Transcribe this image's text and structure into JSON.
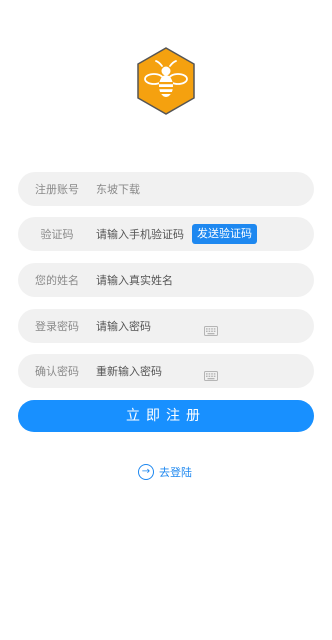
{
  "form": {
    "account": {
      "label": "注册账号",
      "placeholder": "东坡下载"
    },
    "code": {
      "label": "验证码",
      "placeholder": "请输入手机验证码",
      "send_button": "发送验证码"
    },
    "name": {
      "label": "您的姓名",
      "placeholder": "请输入真实姓名"
    },
    "password": {
      "label": "登录密码",
      "placeholder": "请输入密码",
      "icon": "keyboard-icon"
    },
    "confirm": {
      "label": "确认密码",
      "placeholder": "重新输入密码",
      "icon": "keyboard-icon"
    }
  },
  "register_button": "立即注册",
  "login_link": {
    "text": "去登陆",
    "icon": "arrow-right-circle-icon"
  },
  "colors": {
    "accent": "#1890ff",
    "logo": "#f5a10f",
    "field_bg": "#f1f1f1"
  },
  "logo_icon": "bee-icon"
}
